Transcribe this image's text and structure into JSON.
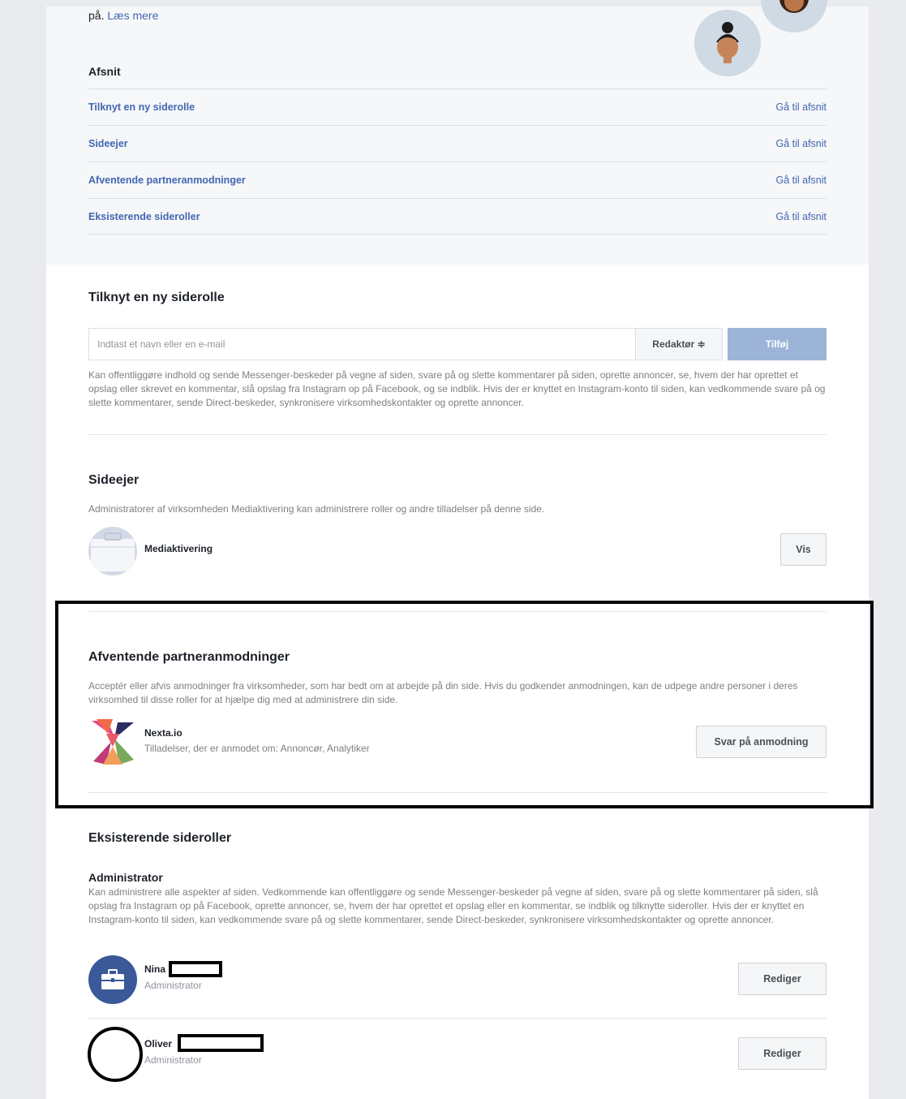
{
  "intro": {
    "prefix": "på.",
    "read_more": "Læs mere"
  },
  "toc": {
    "title": "Afsnit",
    "items": [
      {
        "label": "Tilknyt en ny siderolle",
        "action": "Gå til afsnit"
      },
      {
        "label": "Sideejer",
        "action": "Gå til afsnit"
      },
      {
        "label": "Afventende partneranmodninger",
        "action": "Gå til afsnit"
      },
      {
        "label": "Eksisterende sideroller",
        "action": "Gå til afsnit"
      }
    ]
  },
  "assign": {
    "title": "Tilknyt en ny siderolle",
    "placeholder": "Indtast et navn eller en e-mail",
    "role": "Redaktør ≑",
    "add_label": "Tilføj",
    "description": "Kan offentliggøre indhold og sende Messenger-beskeder på vegne af siden, svare på og slette kommentarer på siden, oprette annoncer, se, hvem der har oprettet et opslag eller skrevet en kommentar, slå opslag fra Instagram op på Facebook, og se indblik. Hvis der er knyttet en Instagram-konto til siden, kan vedkommende svare på og slette kommentarer, sende Direct-beskeder, synkronisere virksomhedskontakter og oprette annoncer."
  },
  "owner": {
    "title": "Sideejer",
    "description": "Administratorer af virksomheden Mediaktivering kan administrere roller og andre tilladelser på denne side.",
    "name": "Mediaktivering",
    "view_label": "Vis"
  },
  "pending": {
    "title": "Afventende partneranmodninger",
    "description": "Acceptér eller afvis anmodninger fra virksomheder, som har bedt om at arbejde på din side. Hvis du godkender anmodningen, kan de udpege andre personer i deres virksomhed til disse roller for at hjælpe dig med at administrere din side.",
    "partner_name": "Nexta.io",
    "permissions": "Tilladelser, der er anmodet om: Annoncør, Analytiker",
    "respond_label": "Svar på anmodning"
  },
  "existing": {
    "title": "Eksisterende sideroller",
    "role_title": "Administrator",
    "role_description": "Kan administrere alle aspekter af siden. Vedkommende kan offentliggøre og sende Messenger-beskeder på vegne af siden, svare på og slette kommentarer på siden, slå opslag fra Instagram op på Facebook, oprette annoncer, se, hvem der har oprettet et opslag eller en kommentar, se indblik og tilknytte sideroller. Hvis der er knyttet en Instagram-konto til siden, kan vedkommende svare på og slette kommentarer, sende Direct-beskeder, synkronisere virksomhedskontakter og oprette annoncer.",
    "people": [
      {
        "name": "Nina",
        "role": "Administrator",
        "edit_label": "Rediger"
      },
      {
        "name": "Oliver",
        "role": "Administrator",
        "edit_label": "Rediger"
      }
    ]
  },
  "colors": {
    "link": "#4267b2",
    "add_button": "#9cb4d8",
    "avatar_blue": "#3b5998"
  }
}
